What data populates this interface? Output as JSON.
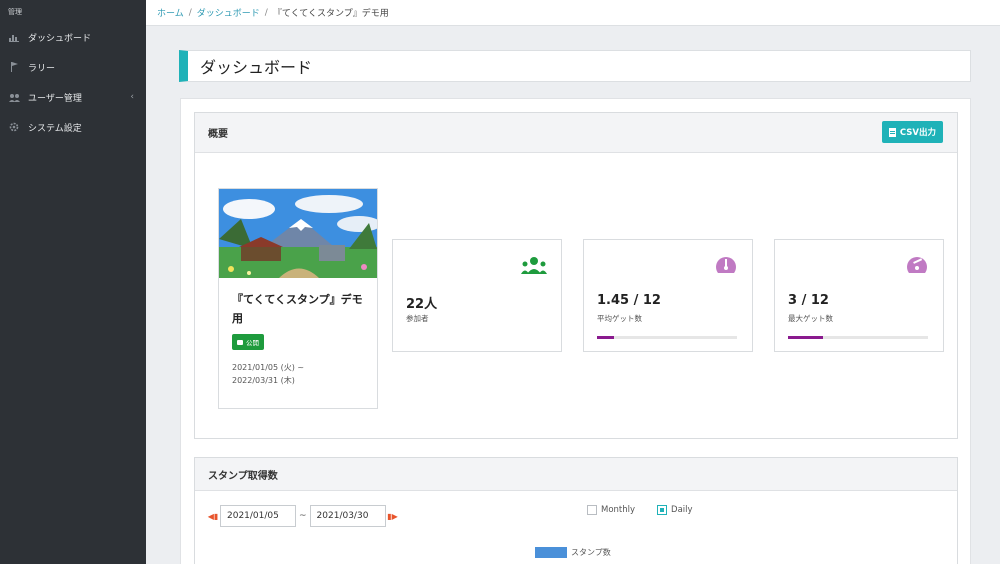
{
  "sidebar": {
    "header": "管理",
    "items": [
      {
        "label": "ダッシュボード",
        "icon": "chart-icon"
      },
      {
        "label": "ラリー",
        "icon": "flag-icon"
      },
      {
        "label": "ユーザー管理",
        "icon": "users-icon",
        "chevron": "‹"
      },
      {
        "label": "システム設定",
        "icon": "gear-icon"
      }
    ]
  },
  "breadcrumb": {
    "home": "ホーム",
    "dashboard": "ダッシュボード",
    "current": "『てくてくスタンプ』デモ用",
    "sep": "/"
  },
  "page": {
    "title": "ダッシュボード"
  },
  "overview": {
    "heading": "概要",
    "csv_button": "CSV出力",
    "rally": {
      "name": "『てくてくスタンプ』デモ用",
      "status": "公開",
      "date_start": "2021/01/05 (火) ~",
      "date_end": "2022/03/31 (木)"
    },
    "stats": [
      {
        "value": "22人",
        "label": "参加者",
        "icon": "participants-icon"
      },
      {
        "value": "1.45 / 12",
        "label": "平均ゲット数",
        "icon": "gauge-icon",
        "progress": 0.121
      },
      {
        "value": "3 / 12",
        "label": "最大ゲット数",
        "icon": "gauge-icon",
        "progress": 0.25
      }
    ]
  },
  "stamps": {
    "heading": "スタンプ取得数",
    "from": "2021/01/05",
    "to": "2021/03/30",
    "tilde": "~",
    "monthly": "Monthly",
    "daily": "Daily",
    "legend": "スタンプ数"
  },
  "colors": {
    "accent": "#1fb2b8",
    "sidebar": "#2d3136",
    "progress": "#8a1a8e",
    "badge": "#1e9b3d",
    "series": "#4a90d9"
  }
}
